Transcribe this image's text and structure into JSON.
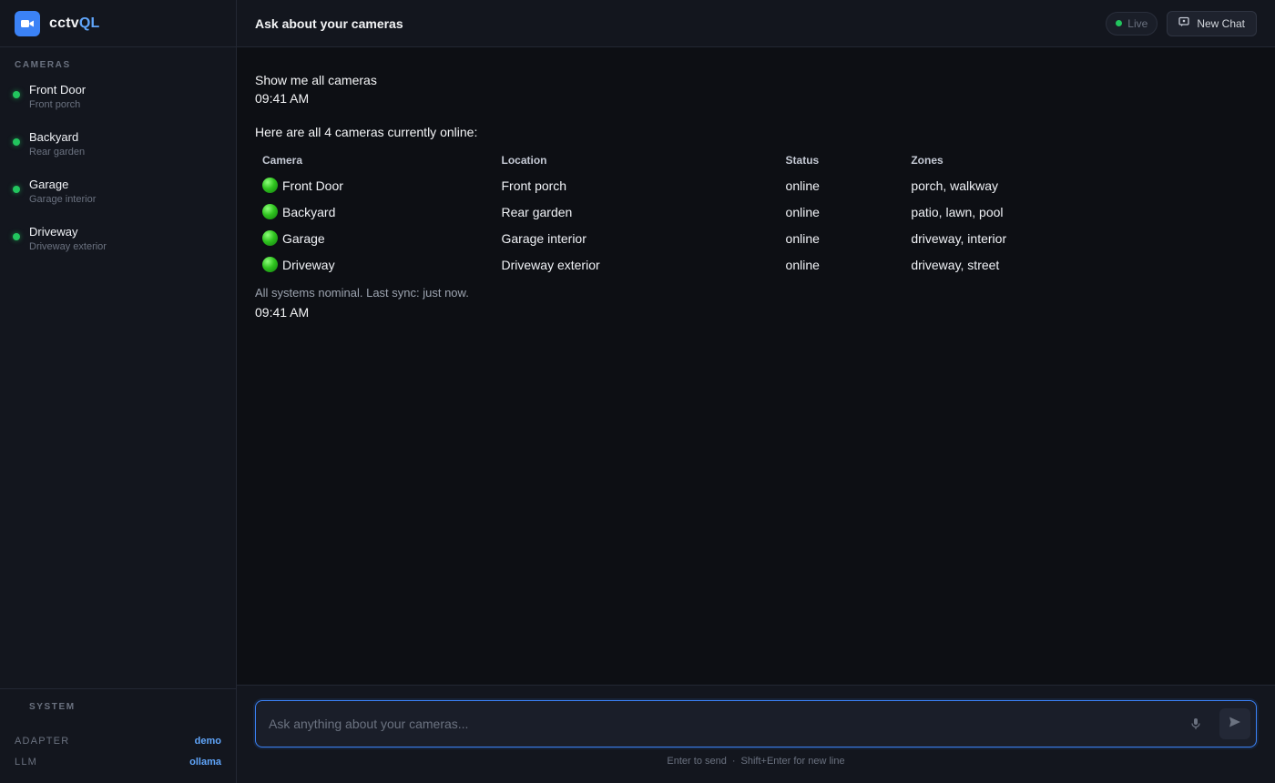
{
  "brand": {
    "name_main": "cctv",
    "name_accent": "QL"
  },
  "sidebar": {
    "cameras_label": "CAMERAS",
    "cameras": [
      {
        "name": "Front Door",
        "location": "Front porch"
      },
      {
        "name": "Backyard",
        "location": "Rear garden"
      },
      {
        "name": "Garage",
        "location": "Garage interior"
      },
      {
        "name": "Driveway",
        "location": "Driveway exterior"
      }
    ],
    "system_label": "SYSTEM",
    "system": [
      {
        "key": "ADAPTER",
        "value": "demo"
      },
      {
        "key": "LLM",
        "value": "ollama"
      }
    ]
  },
  "header": {
    "title": "Ask about your cameras",
    "live_label": "Live",
    "new_chat_label": "New Chat"
  },
  "chat": {
    "user_message": "Show me all cameras",
    "user_time": "09:41 AM",
    "assistant_intro": "Here are all 4 cameras currently online:",
    "table_headers": [
      "Camera",
      "Location",
      "Status",
      "Zones"
    ],
    "rows": [
      {
        "camera": "Front Door",
        "location": "Front porch",
        "status": "online",
        "zones": "porch, walkway"
      },
      {
        "camera": "Backyard",
        "location": "Rear garden",
        "status": "online",
        "zones": "patio, lawn, pool"
      },
      {
        "camera": "Garage",
        "location": "Garage interior",
        "status": "online",
        "zones": "driveway, interior"
      },
      {
        "camera": "Driveway",
        "location": "Driveway exterior",
        "status": "online",
        "zones": "driveway, street"
      }
    ],
    "summary": "All systems nominal. Last sync: just now.",
    "assistant_time": "09:41 AM"
  },
  "composer": {
    "placeholder": "Ask anything about your cameras...",
    "hint_send": "Enter to send",
    "hint_sep": "·",
    "hint_newline": "Shift+Enter for new line"
  },
  "colors": {
    "accent": "#3b82f6",
    "online": "#22c55e",
    "link": "#60a5fa"
  },
  "icons": {
    "logo": "video-camera-icon",
    "new_chat": "chat-icon",
    "mic": "microphone-icon",
    "send": "send-icon",
    "status": "green-circle-icon"
  }
}
